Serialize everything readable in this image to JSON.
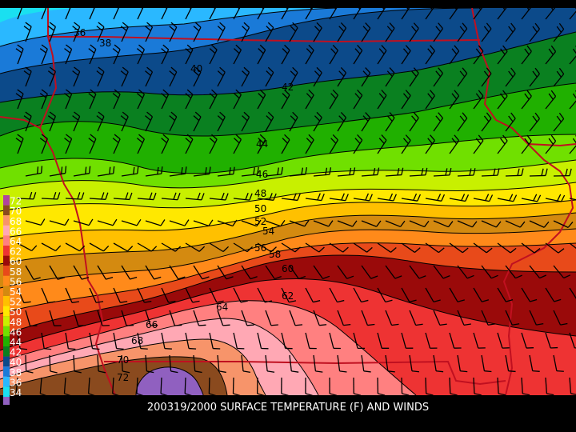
{
  "caption": "200319/2000 SURFACE TEMPERATURE (F) AND WINDS",
  "legend": {
    "bands": [
      {
        "value": "72",
        "color": "#b0449e"
      },
      {
        "value": "70",
        "color": "#8a4a1e"
      },
      {
        "value": "68",
        "color": "#f7946a"
      },
      {
        "value": "66",
        "color": "#ffa8b4"
      },
      {
        "value": "64",
        "color": "#ff8080"
      },
      {
        "value": "62",
        "color": "#ee3333"
      },
      {
        "value": "60",
        "color": "#9a0a0a"
      },
      {
        "value": "58",
        "color": "#e84a1a"
      },
      {
        "value": "56",
        "color": "#ff8a1a"
      },
      {
        "value": "54",
        "color": "#d48a10"
      },
      {
        "value": "52",
        "color": "#ffc000"
      },
      {
        "value": "50",
        "color": "#ffe800"
      },
      {
        "value": "48",
        "color": "#c8f000"
      },
      {
        "value": "46",
        "color": "#70e000"
      },
      {
        "value": "44",
        "color": "#20b000"
      },
      {
        "value": "42",
        "color": "#0a8020"
      },
      {
        "value": "40",
        "color": "#0c4a8a"
      },
      {
        "value": "38",
        "color": "#1a7ad8"
      },
      {
        "value": "36",
        "color": "#2ab8ff"
      },
      {
        "value": "34",
        "color": "#1ae0f0"
      }
    ],
    "cold_color": "#9060c0"
  },
  "contour_labels": [
    {
      "value": "36",
      "anchor": "nw-a"
    },
    {
      "value": "38",
      "anchor": "nw-b"
    },
    {
      "value": "40",
      "anchor": "n-a"
    },
    {
      "value": "42",
      "anchor": "n-b"
    },
    {
      "value": "44",
      "anchor": "c-a"
    },
    {
      "value": "46",
      "anchor": "c-b"
    },
    {
      "value": "48",
      "anchor": "c-c"
    },
    {
      "value": "50",
      "anchor": "c-d"
    },
    {
      "value": "52",
      "anchor": "c-e"
    },
    {
      "value": "54",
      "anchor": "c-f"
    },
    {
      "value": "56",
      "anchor": "c-g"
    },
    {
      "value": "58",
      "anchor": "c-h"
    },
    {
      "value": "60",
      "anchor": "c-i"
    },
    {
      "value": "62",
      "anchor": "c-j"
    },
    {
      "value": "64",
      "anchor": "s-a"
    },
    {
      "value": "66",
      "anchor": "s-b"
    },
    {
      "value": "68",
      "anchor": "s-c"
    },
    {
      "value": "70",
      "anchor": "s-d"
    },
    {
      "value": "72",
      "anchor": "s-e"
    }
  ],
  "colors": {
    "state_border": "#c01020",
    "wind_barb": "#000000",
    "background": "#000000"
  }
}
